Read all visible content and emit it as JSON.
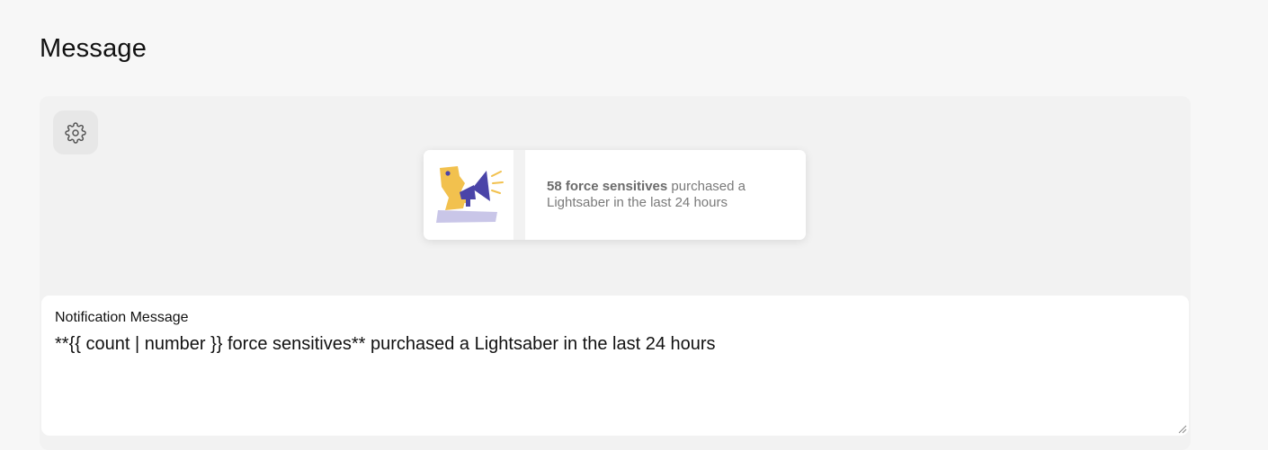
{
  "page": {
    "title": "Message"
  },
  "preview": {
    "settings_icon": "gear-icon",
    "notification": {
      "image_icon": "megaphone-person-illustration",
      "bold_text": "58 force sensitives",
      "rest_text": " purchased a Lightsaber in the last 24 hours"
    }
  },
  "message_field": {
    "label": "Notification Message",
    "value": "**{{ count | number }} force sensitives** purchased a Lightsaber in the last 24 hours"
  },
  "colors": {
    "page_background": "#f7f7f7",
    "panel_background": "#f2f2f2",
    "illustration_yellow": "#f2c14e",
    "illustration_purple": "#4a44a8",
    "illustration_lavender": "#c9c6e8"
  }
}
